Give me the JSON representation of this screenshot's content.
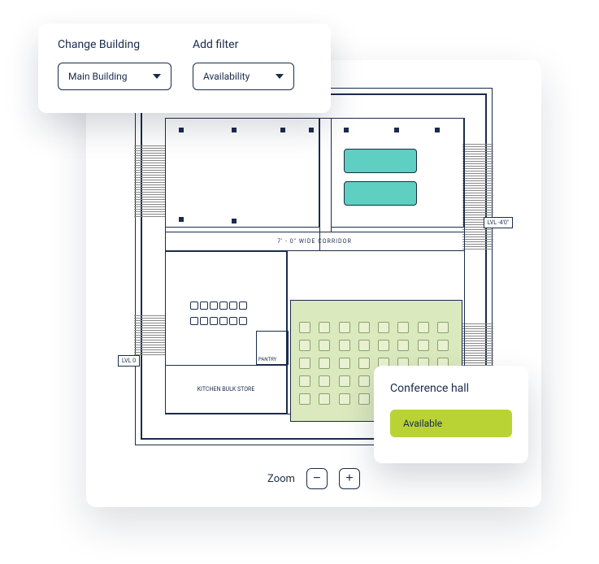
{
  "filters": {
    "building_label": "Change Building",
    "building_value": "Main Building",
    "add_filter_label": "Add filter",
    "add_filter_value": "Availability"
  },
  "floorplan": {
    "corridor_label": "7' - 0\" WIDE CORRIDOR",
    "kitchen_label": "KITCHEN BULK STORE",
    "pantry_label": "PANTRY",
    "level_right": "LVL -4'0\"",
    "level_left": "LVL 0"
  },
  "zoom": {
    "label": "Zoom",
    "minus": "−",
    "plus": "+"
  },
  "popover": {
    "title": "Conference hall",
    "status": "Available"
  }
}
